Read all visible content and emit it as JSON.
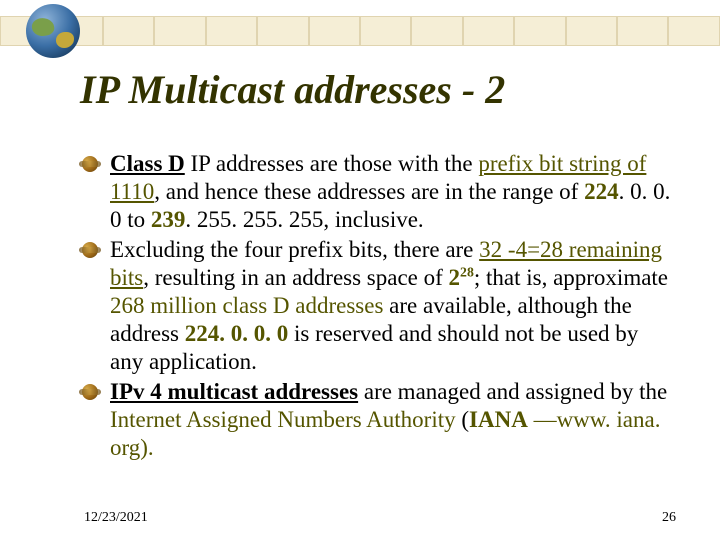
{
  "title": "IP Multicast addresses - 2",
  "bullets": [
    {
      "class_d": "Class D",
      "t1": " IP addresses are those with the ",
      "prefix_bit_string": "prefix bit string of 1110",
      "t2": ", and hence these addresses are in the range of ",
      "range_low": "224",
      "range_low_rest": ". 0. 0. 0",
      "to": "  to ",
      "range_high": "239",
      "range_high_rest": ". 255. 255. 255, inclusive."
    },
    {
      "t1": "Excluding the four prefix bits, there are ",
      "calc": "32 -4=28 remaining bits",
      "t2": ", resulting in an address space of ",
      "power_base": "2",
      "power_exp": "28",
      "t3": "; that is, approximate ",
      "approx": "268 million class D addresses",
      "t4": " are available, although the address ",
      "reserved": "224. 0. 0. 0",
      "t5": " is reserved and should not be used by any application."
    },
    {
      "ipv4": "IPv 4 multicast addresses",
      "t1": " are managed and assigned by the ",
      "iana_full": "Internet Assigned Numbers Authority",
      "open": " (",
      "iana": "IANA",
      "dash": " —",
      "url": "www. iana. org",
      "close": ")."
    }
  ],
  "footer": {
    "date": "12/23/2021",
    "page": "26"
  }
}
